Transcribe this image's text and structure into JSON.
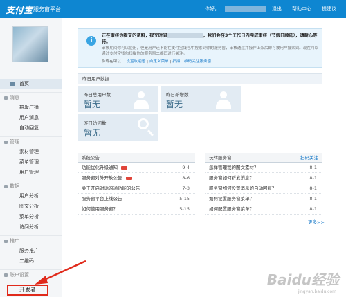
{
  "header": {
    "logo": "支付宝",
    "platform": "服务窗平台",
    "greeting": "你好，",
    "logout": "退出",
    "help": "帮助中心",
    "feedback": "提建议"
  },
  "sidebar": {
    "home": "首页",
    "sections": [
      {
        "title": "消息",
        "items": [
          "群发广播",
          "用户消息",
          "自动回复"
        ]
      },
      {
        "title": "管理",
        "items": [
          "素材管理",
          "菜单管理",
          "用户管理"
        ]
      },
      {
        "title": "数据",
        "items": [
          "用户分析",
          "图文分析",
          "菜单分析",
          "访问分析"
        ]
      },
      {
        "title": "推广",
        "items": [
          "服务推广",
          "二维码"
        ]
      }
    ],
    "account": "账户设置",
    "developer": "开发者"
  },
  "notice": {
    "line1": "正在审核你提交的资料，提交时间",
    "line1b": "，我们会在3个工作日内完成审核（节假日顺延），请耐心等待。",
    "line2": "审核期间你可以使用，但是用户还不能在支付宝钱包中搜索到你的服务窗，审核通过并操作上架后即可被用户搜索到。现在可以通过支付宝钱包扫描你的服务窗二维码进行关注。",
    "line3_prefix": "你现在可以：",
    "links": [
      "设置欢迎语",
      "自定义菜单",
      "扫描二维码关注服务窗"
    ]
  },
  "stats": {
    "header": "昨日用户数据",
    "items": [
      {
        "label": "昨日总用户数",
        "value": "暂无"
      },
      {
        "label": "昨日新增数",
        "value": "暂无"
      },
      {
        "label": "昨日访问数",
        "value": "暂无"
      }
    ]
  },
  "announcements": {
    "title": "系统公告",
    "rows": [
      {
        "text": "功能优化升级通知",
        "date": "9-4",
        "badge": true
      },
      {
        "text": "服务窗对外开放公告",
        "date": "8-6",
        "badge": true
      },
      {
        "text": "关于开启对话沟通功能的公告",
        "date": "7-3",
        "badge": false
      },
      {
        "text": "服务窗平台上线公告",
        "date": "5-15",
        "badge": false
      },
      {
        "text": "如何使用服务窗？",
        "date": "5-15",
        "badge": false
      }
    ]
  },
  "tips": {
    "title": "玩转服务窗",
    "action": "扫码关注",
    "rows": [
      {
        "text": "怎样管理我的图文素材？",
        "date": "8-1"
      },
      {
        "text": "服务窗如何群发消息？",
        "date": "8-1"
      },
      {
        "text": "服务窗如何设置消息的自动回复？",
        "date": "8-1"
      },
      {
        "text": "如何设置服务窗菜单？",
        "date": "8-1"
      },
      {
        "text": "如何配置服务窗菜单？",
        "date": "8-1"
      }
    ],
    "more": "更多>>"
  },
  "watermark": {
    "text": "Baidu经验",
    "sub": "jingyan.baidu.com"
  }
}
